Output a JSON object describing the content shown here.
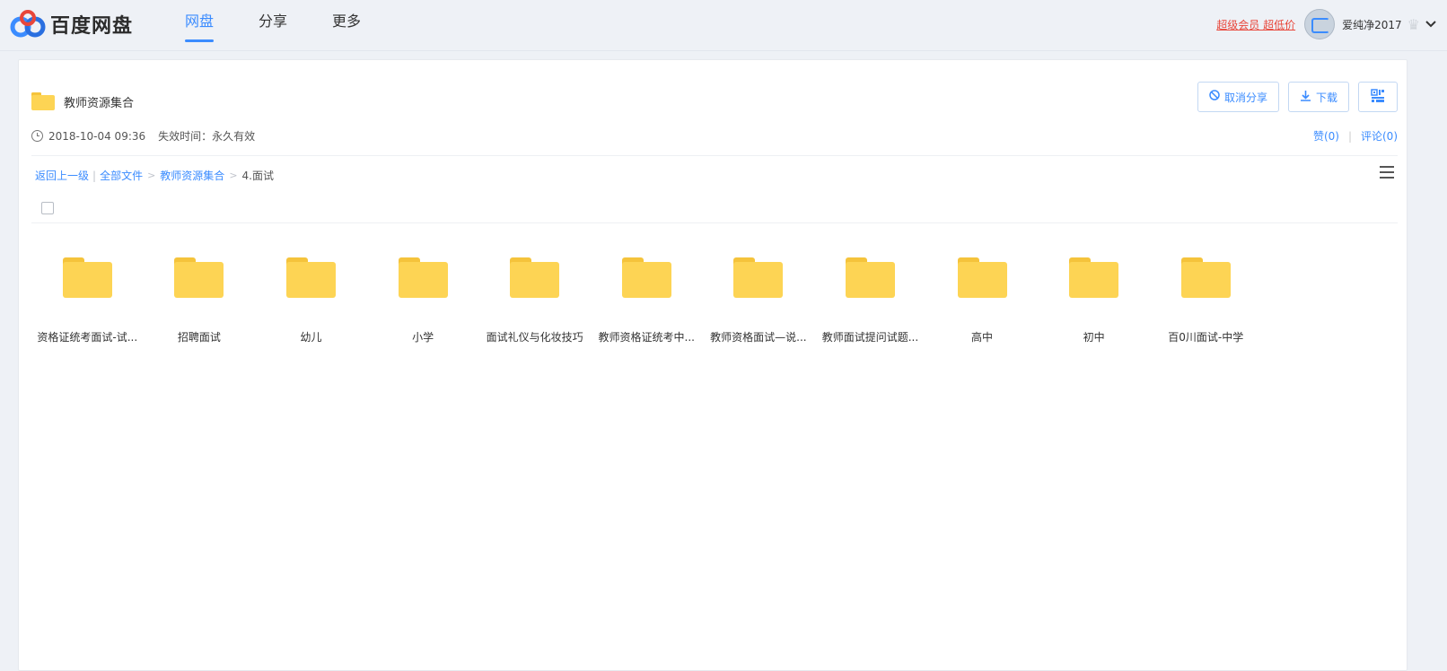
{
  "topbar": {
    "logo_text": "百度网盘",
    "nav": [
      {
        "label": "网盘",
        "active": true
      },
      {
        "label": "分享",
        "active": false
      },
      {
        "label": "更多",
        "active": false
      }
    ],
    "vip_text": "超级会员 超低价",
    "username": "爱纯净2017",
    "crown_icon": "crown-icon",
    "accent_color": "#3b8cff"
  },
  "share": {
    "title": "教师资源集合",
    "date": "2018-10-04 09:36",
    "expire": "失效时间：永久有效",
    "actions": {
      "cancel_share": "取消分享",
      "download": "下载"
    },
    "like": "赞(0)",
    "comment": "评论(0)"
  },
  "breadcrumb": {
    "back": "返回上一级",
    "all_files": "全部文件",
    "folder": "教师资源集合",
    "current": "4.面试"
  },
  "files": [
    {
      "name": "资格证统考面试-试..."
    },
    {
      "name": "招聘面试"
    },
    {
      "name": "幼儿"
    },
    {
      "name": "小学"
    },
    {
      "name": "面试礼仪与化妆技巧"
    },
    {
      "name": "教师资格证统考中..."
    },
    {
      "name": "教师资格面试—说..."
    },
    {
      "name": "教师面试提问试题..."
    },
    {
      "name": "高中"
    },
    {
      "name": "初中"
    },
    {
      "name": "百0川面试-中学"
    }
  ]
}
